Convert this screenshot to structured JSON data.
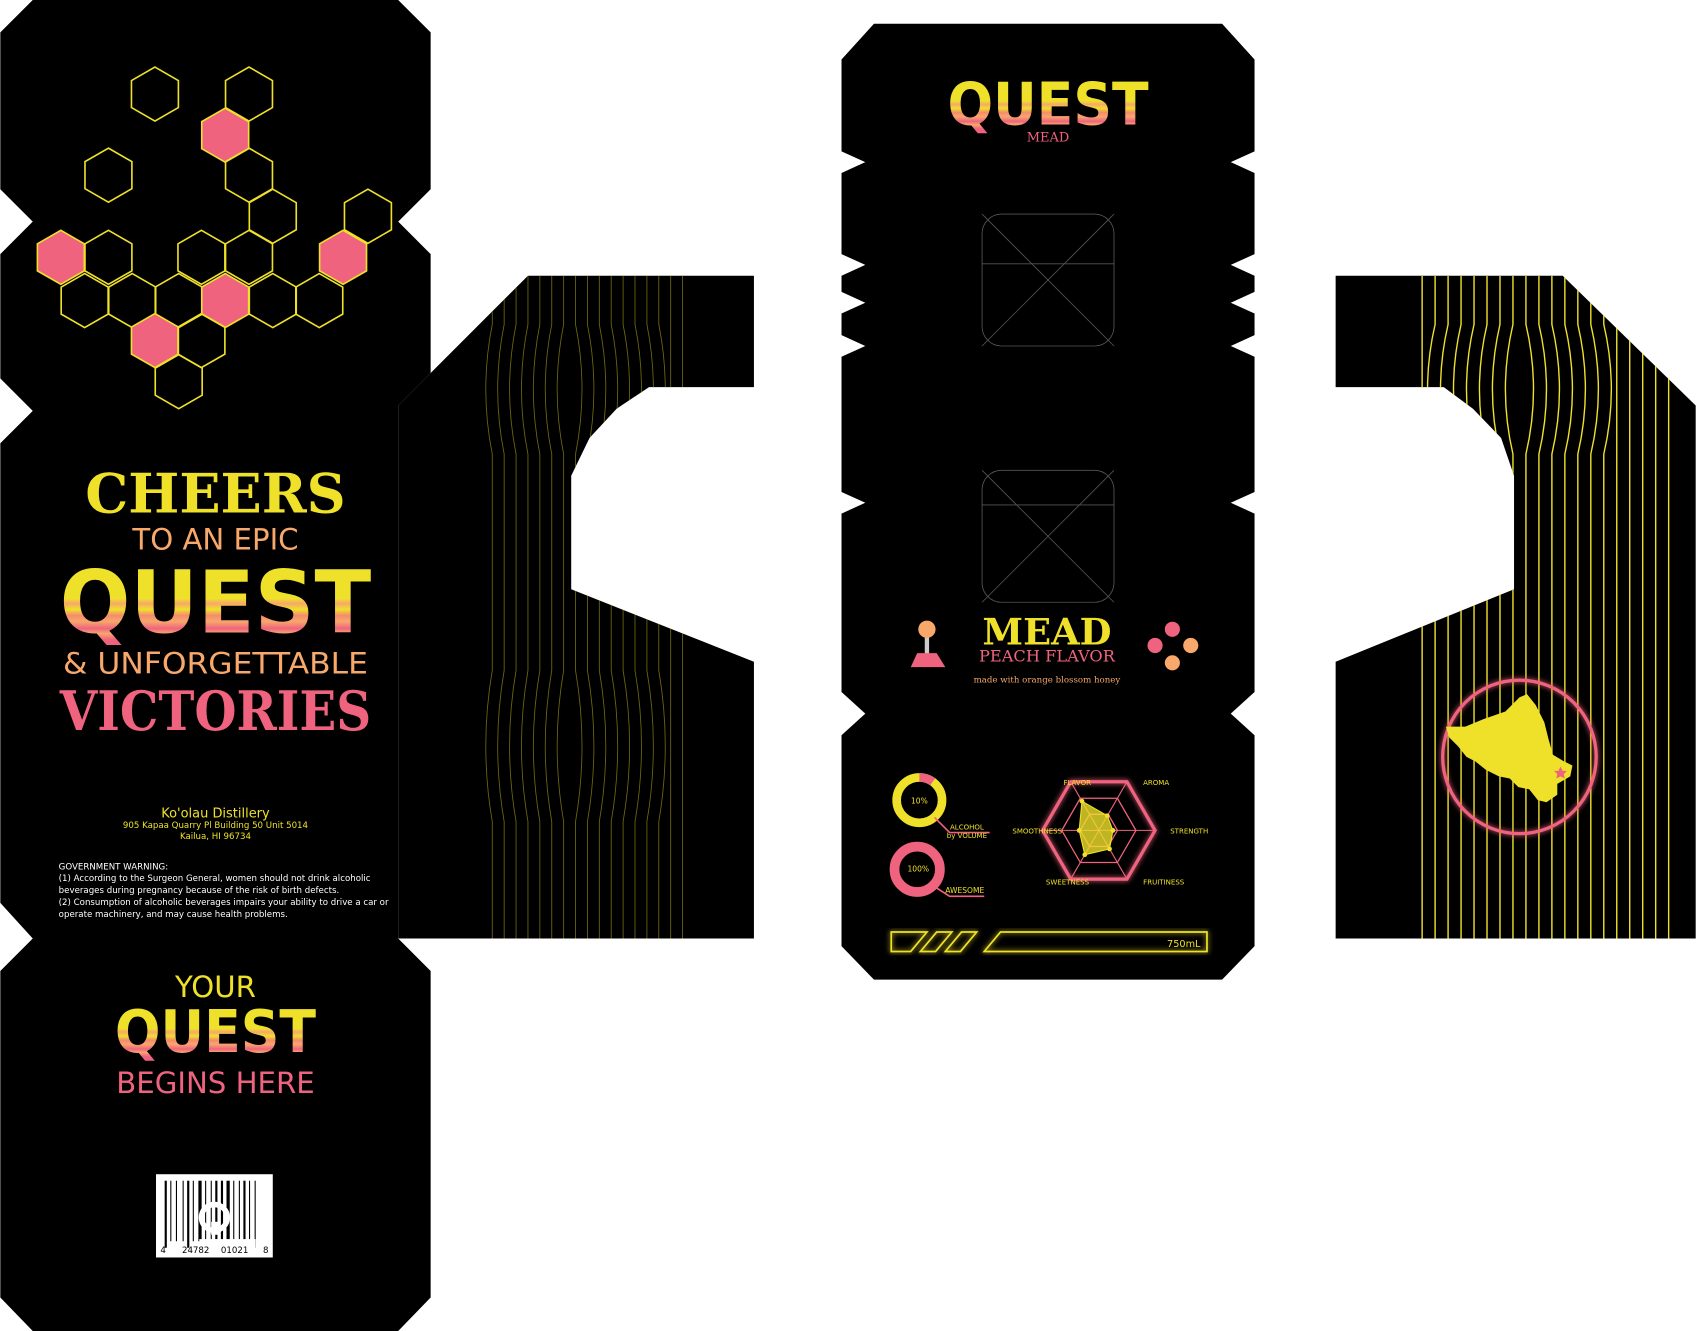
{
  "colors": {
    "yellow": "#efe12a",
    "pink": "#f0637f",
    "peach": "#f7a86a",
    "black": "#000000",
    "dim_line": "#6e6612"
  },
  "back_panel": {
    "cheers": "CHEERS",
    "to_an_epic": "TO AN EPIC",
    "quest": "QUEST",
    "unforgettable": "& UNFORGETTABLE",
    "victories": "VICTORIES",
    "distillery": "Ko'olau Distillery",
    "address_1": "905 Kapaa Quarry Pl Building 50 Unit 5014",
    "address_2": "Kailua, HI 96734",
    "warning_title": "GOVERNMENT WARNING:",
    "warning_lines": [
      "(1) According to the Surgeon General, women should not drink alcoholic",
      "beverages during pregnancy because of the risk of birth defects.",
      "(2) Consumption of alcoholic beverages impairs your ability to drive a car or",
      "operate machinery, and may cause health problems."
    ]
  },
  "bottom_flap": {
    "your": "YOUR",
    "quest": "QUEST",
    "begins": "BEGINS HERE",
    "barcode_left": "4",
    "barcode_mid1": "24782",
    "barcode_mid2": "01021",
    "barcode_right": "8"
  },
  "front_panel": {
    "logo": "QUEST",
    "logo_sub": "MEAD",
    "product": "MEAD",
    "flavor": "PEACH FLAVOR",
    "tagline": "made with orange blossom honey",
    "joystick_icon": "joystick-icon",
    "buttons_icon": "gamepad-buttons-icon"
  },
  "stats": {
    "abv": {
      "value_label": "10%",
      "fraction": 0.1,
      "label_1": "ALCOHOL",
      "label_2": "by VOLUME"
    },
    "awesome": {
      "value_label": "100%",
      "fraction": 1.0,
      "label": "AWESOME"
    },
    "radar": {
      "axes": [
        "FLAVOR",
        "AROMA",
        "STRENGTH",
        "FRUITINESS",
        "SWEETNESS",
        "SMOOTHNESS"
      ],
      "values": [
        0.6,
        0.3,
        0.25,
        0.38,
        0.5,
        0.35
      ]
    },
    "volume": "750mL"
  },
  "side_panel_right": {
    "map_icon": "oahu-island-map-icon"
  }
}
